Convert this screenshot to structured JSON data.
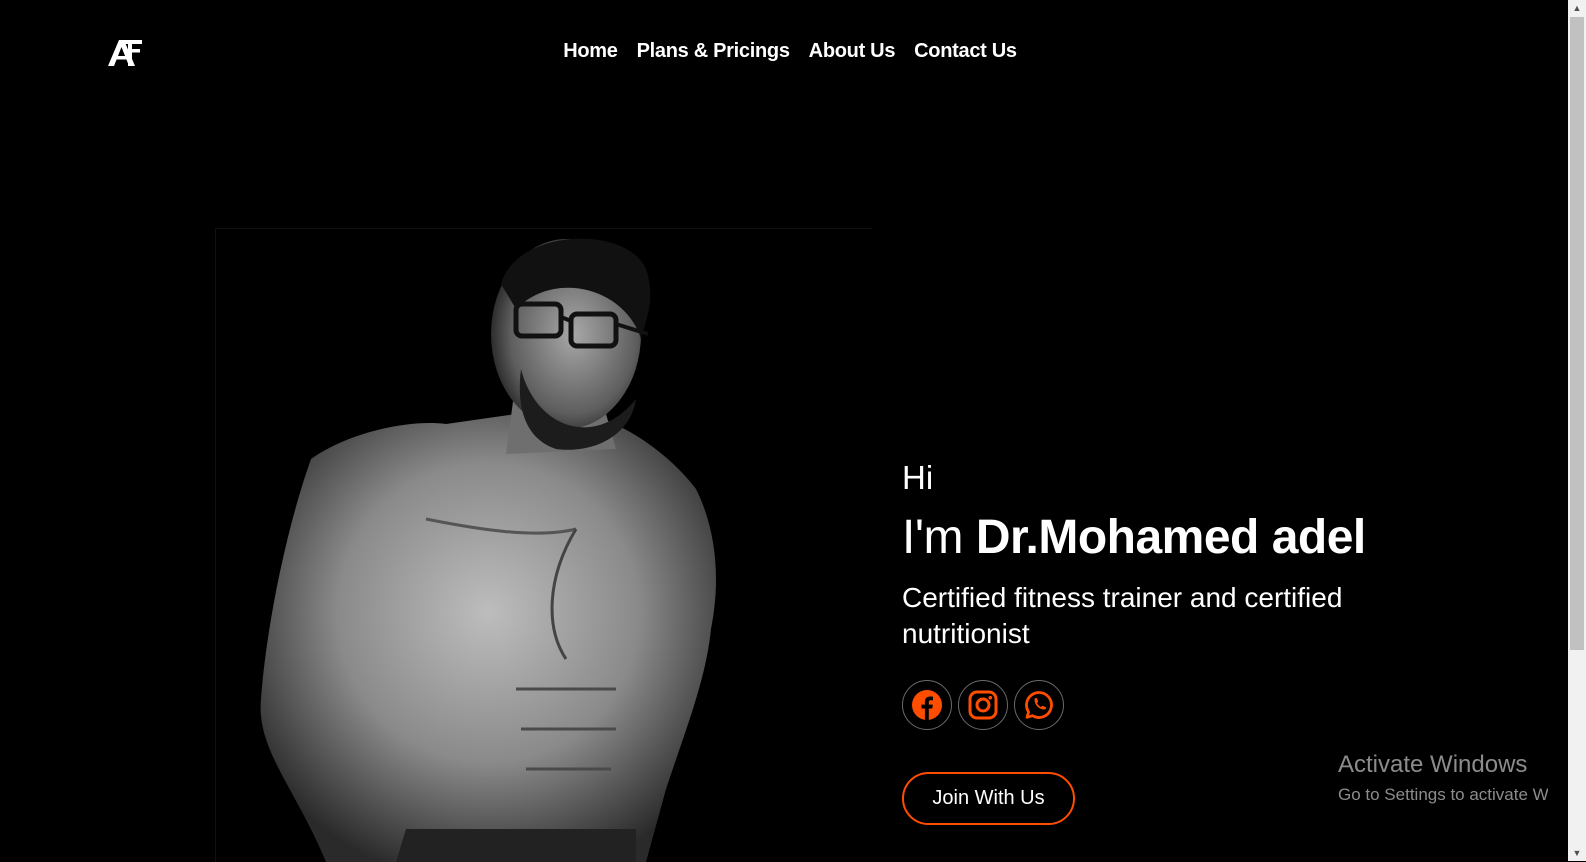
{
  "header": {
    "logo_text": "AF",
    "nav": [
      {
        "label": "Home"
      },
      {
        "label": "Plans & Pricings"
      },
      {
        "label": "About Us"
      },
      {
        "label": "Contact Us"
      }
    ]
  },
  "hero": {
    "greeting": "Hi",
    "intro_prefix": "I'm ",
    "name": "Dr.Mohamed adel",
    "subtitle": "Certified fitness trainer and certified nutritionist",
    "cta_label": "Join With Us",
    "socials": [
      {
        "icon": "facebook-icon"
      },
      {
        "icon": "instagram-icon"
      },
      {
        "icon": "whatsapp-icon"
      }
    ]
  },
  "photo": {
    "description_icon": "trainer-portrait"
  },
  "watermark": {
    "title": "Activate Windows",
    "subtitle": "Go to Settings to activate Windows."
  },
  "colors": {
    "background": "#000000",
    "accent": "#ff4d00",
    "icon_circle_border": "#6a6a6a"
  }
}
